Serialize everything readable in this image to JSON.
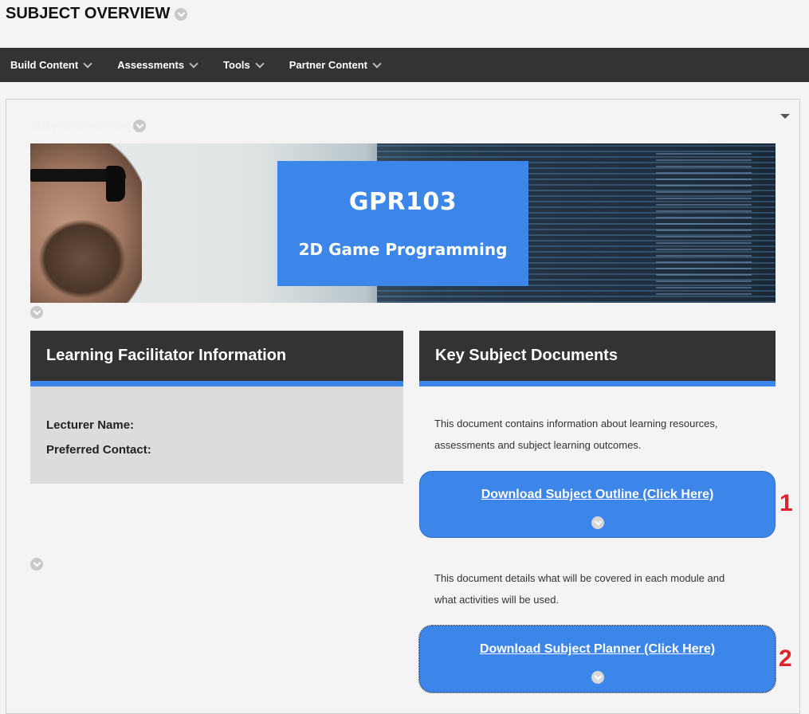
{
  "page": {
    "title": "SUBJECT OVERVIEW"
  },
  "nav": {
    "items": [
      {
        "label": "Build Content"
      },
      {
        "label": "Assessments"
      },
      {
        "label": "Tools"
      },
      {
        "label": "Partner Content"
      }
    ]
  },
  "content": {
    "section_title": "Subject Overview",
    "banner": {
      "course_code": "GPR103",
      "course_name": "2D Game Programming"
    },
    "facilitator": {
      "heading": "Learning Facilitator Information",
      "lecturer_label": "Lecturer Name:",
      "contact_label": "Preferred Contact:"
    },
    "documents": {
      "heading": "Key Subject Documents",
      "outline_desc_line1": "This document contains information about learning resources,",
      "outline_desc_line2": "assessments and subject learning outcomes.",
      "outline_button": "Download Subject Outline (Click Here)",
      "outline_marker": "1",
      "planner_desc_line1": "This document details what will be covered in each module and",
      "planner_desc_line2": "what activities will be used.",
      "planner_button": "Download Subject Planner (Click Here)",
      "planner_marker": "2"
    }
  },
  "colors": {
    "accent_blue": "#3c86ea",
    "nav_bg": "#333333",
    "marker_red": "#e0242b"
  }
}
